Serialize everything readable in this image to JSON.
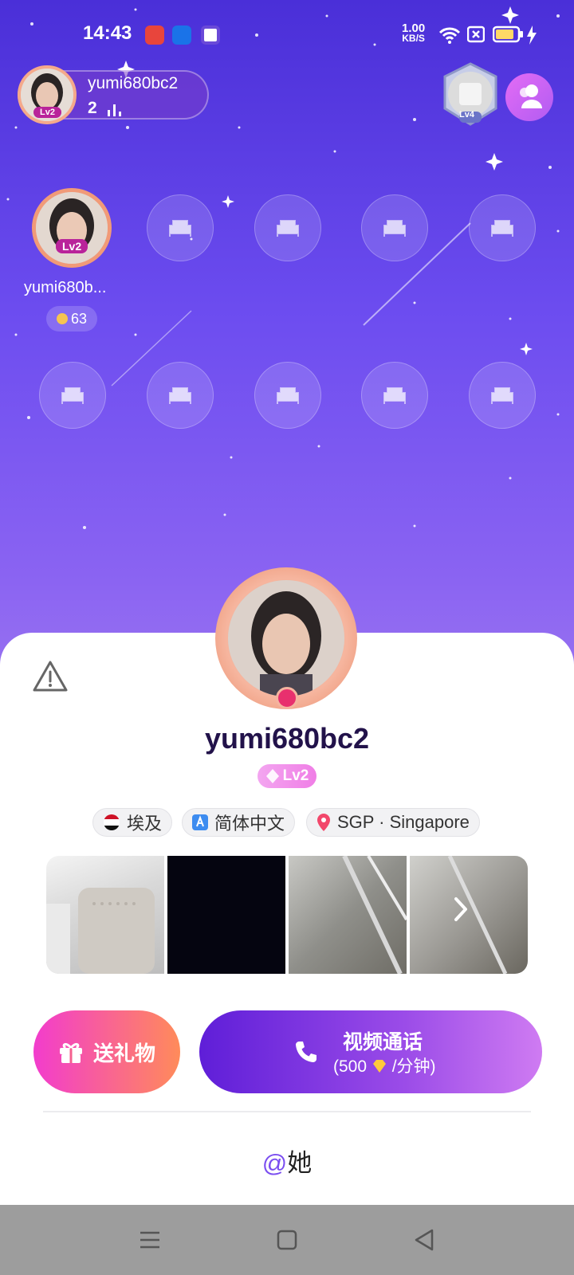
{
  "status_bar": {
    "time": "14:43",
    "net_speed_value": "1.00",
    "net_speed_unit": "KB/S",
    "icons": [
      "baidu-icon",
      "app-circle-icon",
      "app-square-icon",
      "wifi-icon",
      "sim-disabled-icon",
      "battery-icon",
      "charging-icon"
    ]
  },
  "room": {
    "host_name": "yumi680bc2",
    "host_level": "Lv2",
    "online_count": "2",
    "rank_badge_level": "Lv4",
    "seats": {
      "occupied": {
        "name": "yumi680b...",
        "level": "Lv2",
        "score": "63"
      },
      "empty_seat_icon": "sofa-icon"
    }
  },
  "profile": {
    "name": "yumi680bc2",
    "level": "Lv2",
    "tags": [
      {
        "icon": "egypt-flag-icon",
        "label": "埃及"
      },
      {
        "icon": "language-icon",
        "label": "简体中文"
      },
      {
        "icon": "location-pin-icon",
        "label": "SGP · Singapore"
      }
    ],
    "actions": {
      "gift_label": "送礼物",
      "call_title": "视频通话",
      "call_price_prefix": "(500",
      "call_price_suffix": "/分钟)"
    },
    "mention_at": "@",
    "mention_label": "她"
  },
  "colors": {
    "accent_purple": "#7b4ef0",
    "gift_gradient_start": "#f23ccd",
    "gift_gradient_end": "#ff8b5a",
    "call_gradient_start": "#5f1ed8",
    "call_gradient_end": "#cf7bf2"
  }
}
